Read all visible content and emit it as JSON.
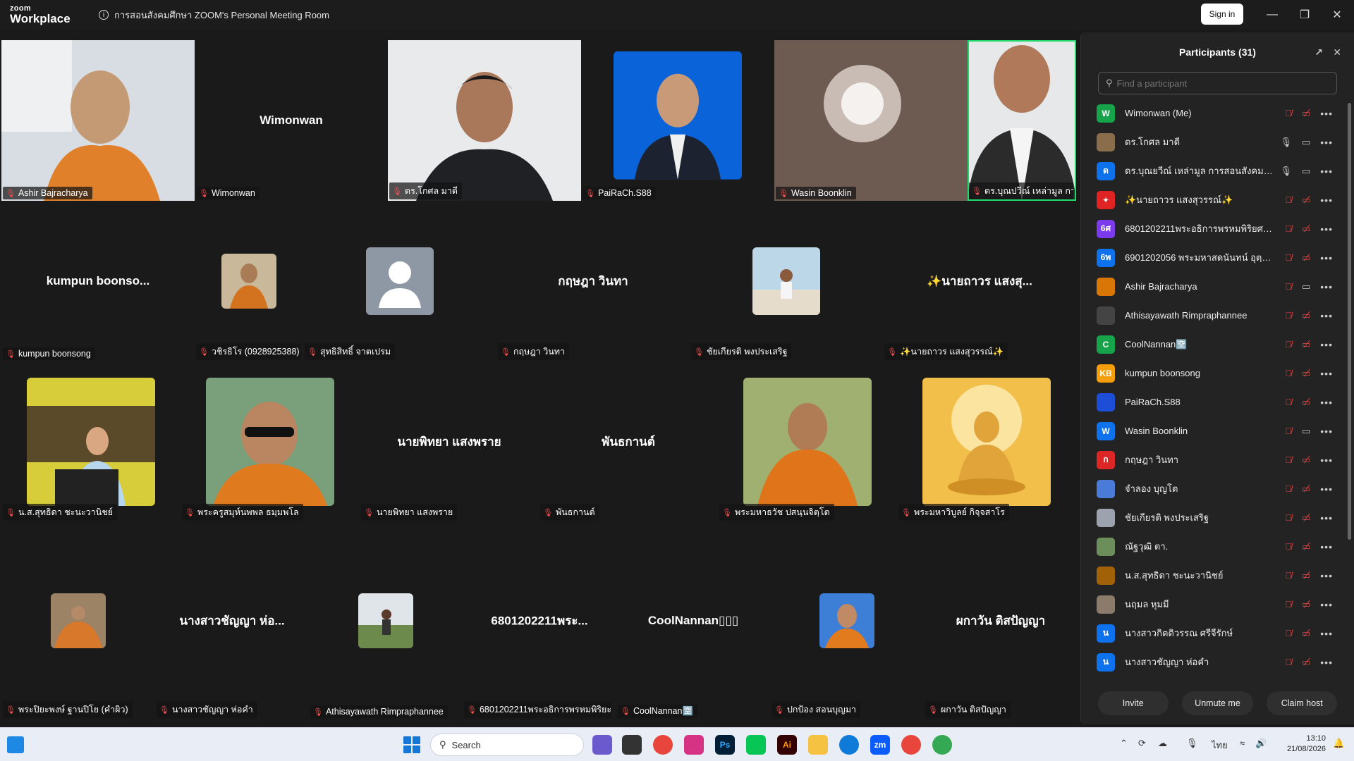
{
  "window": {
    "logo_top": "zoom",
    "logo_bottom": "Workplace",
    "meeting_title": "การสอนสังคมศึกษา ZOOM's Personal Meeting Room",
    "signin_label": "Sign in"
  },
  "tiles": [
    {
      "label": "Ashir Bajracharya",
      "kind": "video",
      "big": ""
    },
    {
      "label": "Wimonwan",
      "kind": "name",
      "big": "Wimonwan"
    },
    {
      "label": "ดร.โกศล มาดี",
      "kind": "video",
      "big": ""
    },
    {
      "label": "PaiRaCh.S88",
      "kind": "photo",
      "big": ""
    },
    {
      "label": "Wasin Boonklin",
      "kind": "video",
      "big": ""
    },
    {
      "label": "ดร.บุณปวีณ์ เหล่ามูล การ...",
      "kind": "video",
      "big": ""
    },
    {
      "label": "kumpun boonsong",
      "kind": "name",
      "big": "kumpun  boonso..."
    },
    {
      "label": "วชิรธิโร (0928925388)",
      "kind": "photo",
      "big": ""
    },
    {
      "label": "สุทธิสิทธิ์ จาตเปรม",
      "kind": "photo",
      "big": ""
    },
    {
      "label": "กฤษฎา วินทา",
      "kind": "name",
      "big": "กฤษฎา วินทา"
    },
    {
      "label": "ชัยเกียรติ พงประเสริฐ",
      "kind": "photo",
      "big": ""
    },
    {
      "label": "✨นายถาวร แสงสุวรรณ์✨",
      "kind": "name",
      "big": "✨นายถาวร แสงสุ..."
    },
    {
      "label": "น.ส.สุทธิดา ชะนะวานิชย์",
      "kind": "photo",
      "big": ""
    },
    {
      "label": "พระครูสมุห์นพพล ธมฺมพโล",
      "kind": "photo",
      "big": ""
    },
    {
      "label": "นายพิทยา แสงพราย",
      "kind": "name",
      "big": "นายพิทยา แสงพราย"
    },
    {
      "label": "พันธกานต์",
      "kind": "name",
      "big": "พันธกานต์"
    },
    {
      "label": "พระมหาธวัช ปสนฺนจิตฺโต",
      "kind": "photo",
      "big": ""
    },
    {
      "label": "พระมหาวิบูลย์ กิจฺจสาโร",
      "kind": "photo",
      "big": ""
    },
    {
      "label": "พระปิยะพงษ์ ฐานปิโย (คำผิว)",
      "kind": "photo",
      "big": ""
    },
    {
      "label": "นางสาวชัญญา ห่อคำ",
      "kind": "name",
      "big": "นางสาวชัญญา ห่อ..."
    },
    {
      "label": "Athisayawath Rimpraphannee",
      "kind": "photo",
      "big": ""
    },
    {
      "label": "6801202211พระอธิการพรหมพิริยะ...",
      "kind": "name",
      "big": "6801202211พระ..."
    },
    {
      "label": "CoolNannan🈳",
      "kind": "name",
      "big": "CoolNannan▯▯▯"
    },
    {
      "label": "ปกป้อง สอนบุญมา",
      "kind": "photo",
      "big": ""
    },
    {
      "label": "ผกาวัน ติสปัญญา",
      "kind": "name",
      "big": "ผกาวัน ติสปัญญา"
    }
  ],
  "panel": {
    "title": "Participants (31)",
    "search_placeholder": "Find a participant",
    "participants": [
      {
        "initials": "W",
        "color": "#16a34a",
        "name": "Wimonwan (Me)",
        "mic": "muted",
        "video": "off"
      },
      {
        "initials": "",
        "color": "#8a6d4a",
        "name": "ดร.โกศล มาดี",
        "mic": "on",
        "video": "on"
      },
      {
        "initials": "ด",
        "color": "#0e72ed",
        "name": "ดร.บุณยวีณ์ เหล่ามูล การสอนสังคมศึก...",
        "mic": "on",
        "video": "on"
      },
      {
        "initials": "✦",
        "color": "#e02424",
        "name": "✨นายถาวร แสงสุวรรณ์✨",
        "mic": "muted",
        "video": "off"
      },
      {
        "initials": "6ศ",
        "color": "#7c3aed",
        "name": "6801202211พระอธิการพรหมพิริยศร สุ...",
        "mic": "muted",
        "video": "off"
      },
      {
        "initials": "6พ",
        "color": "#0e72ed",
        "name": "6901202056 พระมหาสดนันทน์ อุตฺตมเมธี",
        "mic": "muted",
        "video": "off"
      },
      {
        "initials": "",
        "color": "#d97706",
        "name": "Ashir Bajracharya",
        "mic": "muted",
        "video": "on"
      },
      {
        "initials": "",
        "color": "#444444",
        "name": "Athisayawath Rimpraphannee",
        "mic": "muted",
        "video": "off"
      },
      {
        "initials": "C",
        "color": "#16a34a",
        "name": "CoolNannan🈳",
        "mic": "muted",
        "video": "off"
      },
      {
        "initials": "KB",
        "color": "#f59e0b",
        "name": "kumpun boonsong",
        "mic": "muted",
        "video": "off"
      },
      {
        "initials": "",
        "color": "#1d4ed8",
        "name": "PaiRaCh.S88",
        "mic": "muted",
        "video": "off"
      },
      {
        "initials": "W",
        "color": "#0e72ed",
        "name": "Wasin Boonklin",
        "mic": "muted",
        "video": "on"
      },
      {
        "initials": "ก",
        "color": "#dc2626",
        "name": "กฤษฎา วินทา",
        "mic": "muted",
        "video": "off"
      },
      {
        "initials": "",
        "color": "#4a7bd8",
        "name": "จำลอง บุญโต",
        "mic": "muted",
        "video": "off"
      },
      {
        "initials": "",
        "color": "#9ca3af",
        "name": "ชัยเกียรติ พงประเสริฐ",
        "mic": "muted",
        "video": "off"
      },
      {
        "initials": "",
        "color": "#6b8e5a",
        "name": "ณัฐวุฒิ ตา.",
        "mic": "muted",
        "video": "off"
      },
      {
        "initials": "",
        "color": "#a16207",
        "name": "น.ส.สุทธิดา ชะนะวานิชย์",
        "mic": "muted",
        "video": "off"
      },
      {
        "initials": "",
        "color": "#8b7b6b",
        "name": "นฤมล หุมมี",
        "mic": "muted",
        "video": "off"
      },
      {
        "initials": "น",
        "color": "#0e72ed",
        "name": "นางสาวกิตติวรรณ ศรีจีรักษ์",
        "mic": "muted",
        "video": "off"
      },
      {
        "initials": "น",
        "color": "#0e72ed",
        "name": "นางสาวชัญญา ห่อคำ",
        "mic": "muted",
        "video": "off"
      }
    ],
    "invite": "Invite",
    "unmute": "Unmute me",
    "claim": "Claim host"
  },
  "taskbar": {
    "search_placeholder": "Search",
    "lang": "ไทย",
    "time": "13:10",
    "date": "21/08/2026"
  }
}
